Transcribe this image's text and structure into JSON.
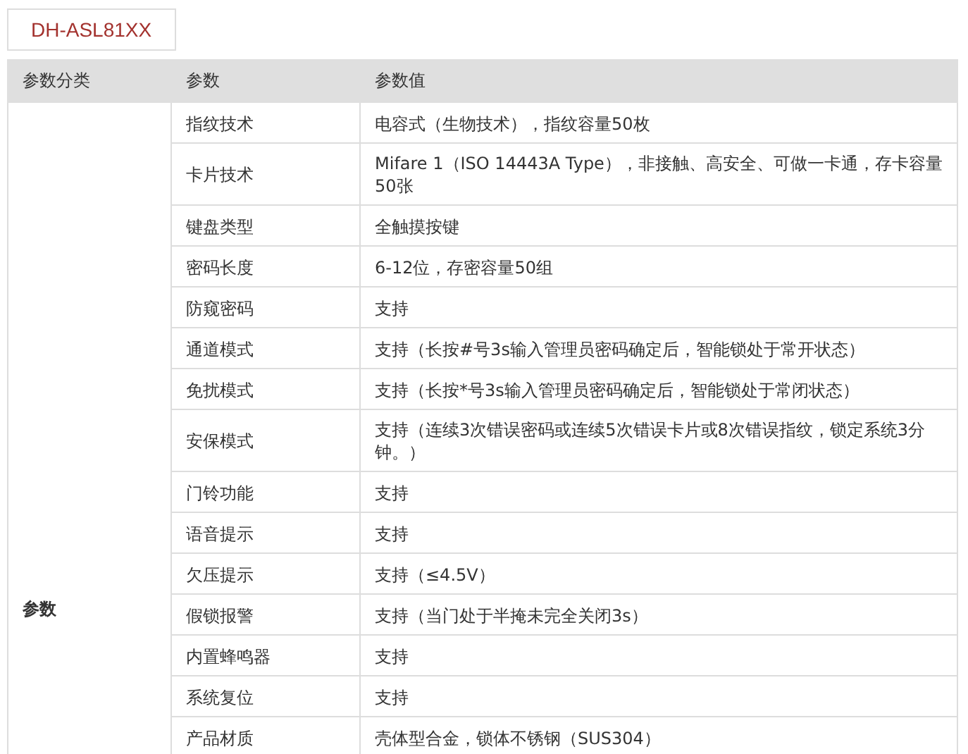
{
  "tab": {
    "label": "DH-ASL81XX"
  },
  "table": {
    "columns": [
      "参数分类",
      "参数",
      "参数值"
    ],
    "category": "参数",
    "rows": [
      {
        "name": "指纹技术",
        "value": "电容式（生物技术），指纹容量50枚"
      },
      {
        "name": "卡片技术",
        "value": "Mifare 1（ISO 14443A Type），非接触、高安全、可做一卡通，存卡容量50张"
      },
      {
        "name": "键盘类型",
        "value": "全触摸按键"
      },
      {
        "name": "密码长度",
        "value": "6-12位，存密容量50组"
      },
      {
        "name": "防窥密码",
        "value": "支持"
      },
      {
        "name": "通道模式",
        "value": "支持（长按#号3s输入管理员密码确定后，智能锁处于常开状态）"
      },
      {
        "name": "免扰模式",
        "value": "支持（长按*号3s输入管理员密码确定后，智能锁处于常闭状态）"
      },
      {
        "name": "安保模式",
        "value": "支持（连续3次错误密码或连续5次错误卡片或8次错误指纹，锁定系统3分钟。）"
      },
      {
        "name": "门铃功能",
        "value": "支持"
      },
      {
        "name": "语音提示",
        "value": "支持"
      },
      {
        "name": "欠压提示",
        "value": "支持（≤4.5V）"
      },
      {
        "name": "假锁报警",
        "value": "支持（当门处于半掩未完全关闭3s）"
      },
      {
        "name": "内置蜂鸣器",
        "value": "支持"
      },
      {
        "name": "系统复位",
        "value": "支持"
      },
      {
        "name": "产品材质",
        "value": "壳体型合金，锁体不锈钢（SUS304）"
      }
    ]
  }
}
